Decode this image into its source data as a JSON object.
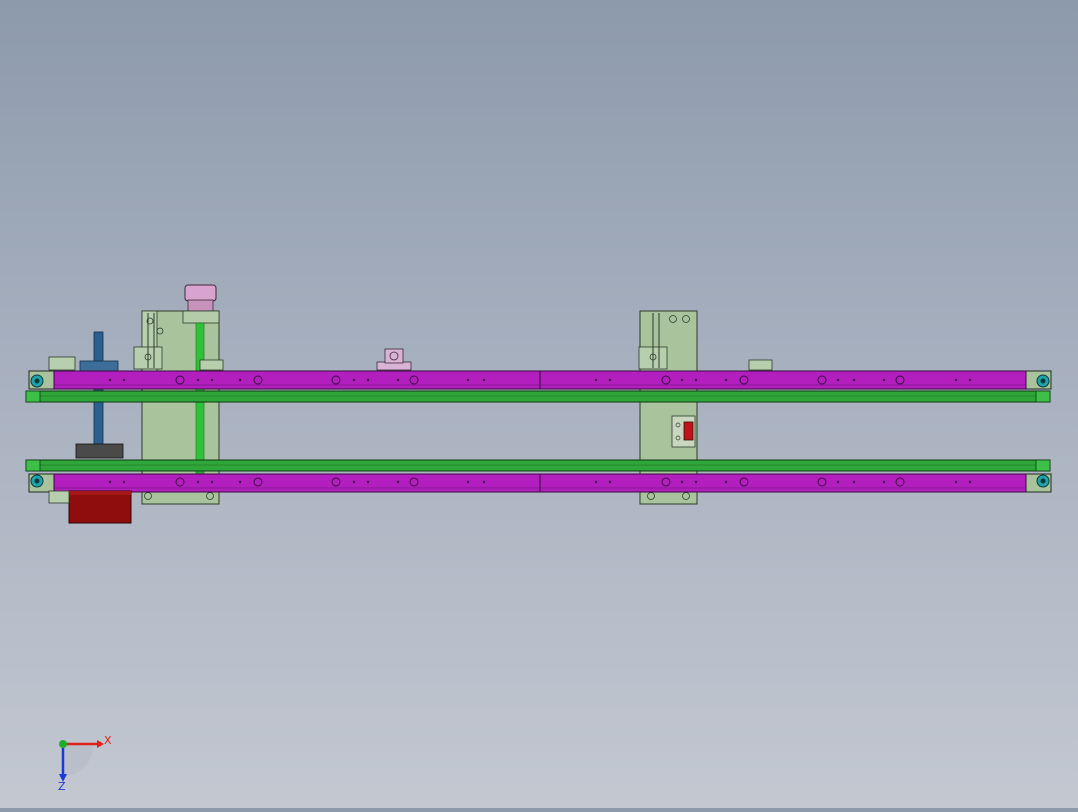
{
  "viewport": {
    "background_top": "#8d9aab",
    "background_bottom": "#c3c8d1",
    "view_orientation": "top"
  },
  "model": {
    "colors": {
      "rail_magenta": "#b21fbe",
      "belt_green": "#2fa63a",
      "plate_green": "#a9c49d",
      "motor_red": "#8f0d0d",
      "shaft_blue": "#2a5f8f",
      "pulley_pink": "#d9a3cf",
      "roller_cyan": "#1fa3a8",
      "sensor_red": "#c0141a"
    }
  },
  "triad": {
    "x_label": "X",
    "z_label": "Z",
    "x_color": "#e0201a",
    "y_color": "#1fae2a",
    "z_color": "#1a3bd6"
  }
}
